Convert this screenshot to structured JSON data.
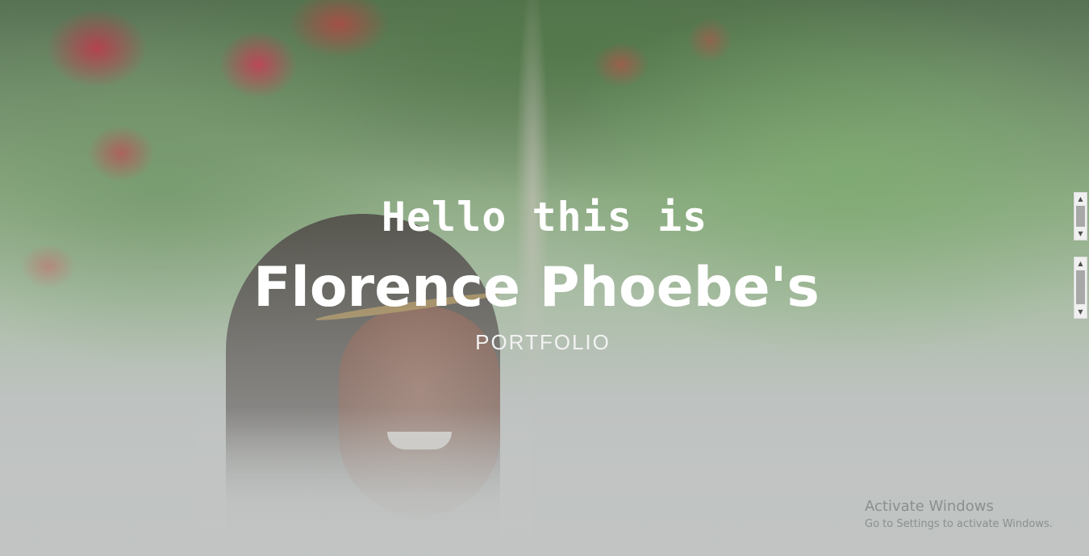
{
  "hero": {
    "greeting": "Hello this is",
    "name": "Florence Phoebe's",
    "subtitle": "PORTFOLIO"
  },
  "scrollbars": {
    "up_arrow": "▲",
    "down_arrow": "▼"
  },
  "watermark": {
    "title": "Activate Windows",
    "subtitle": "Go to Settings to activate Windows."
  }
}
